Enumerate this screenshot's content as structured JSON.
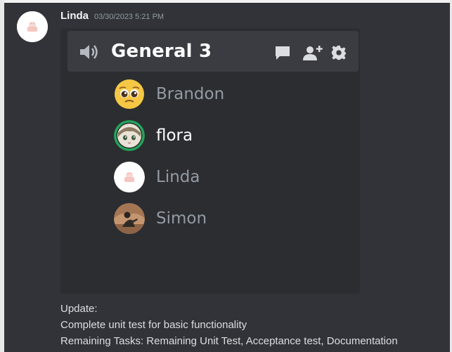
{
  "message": {
    "author": "Linda",
    "timestamp": "03/30/2023 5:21 PM",
    "avatar_icon": "user-avatar-linda",
    "lines": [
      "Update:",
      "Complete unit test for basic functionality",
      "Remaining Tasks: Remaining Unit Test, Acceptance test, Documentation"
    ]
  },
  "voice_card": {
    "channel_name": "General 3",
    "icons": [
      "speaker-icon",
      "chat-icon",
      "add-user-icon",
      "gear-icon"
    ],
    "members": [
      {
        "name": "Brandon",
        "avatar": "pleading-emoji-avatar",
        "speaking": false
      },
      {
        "name": "flora",
        "avatar": "anime-avatar",
        "speaking": true
      },
      {
        "name": "Linda",
        "avatar": "user-avatar-linda",
        "speaking": false
      },
      {
        "name": "Simon",
        "avatar": "photo-avatar",
        "speaking": false
      }
    ]
  },
  "colors": {
    "background": "#313338",
    "embed": "#2b2d31",
    "header": "#3a3c41",
    "speaking_ring": "#23a55a",
    "muted_text": "#949ba4"
  }
}
